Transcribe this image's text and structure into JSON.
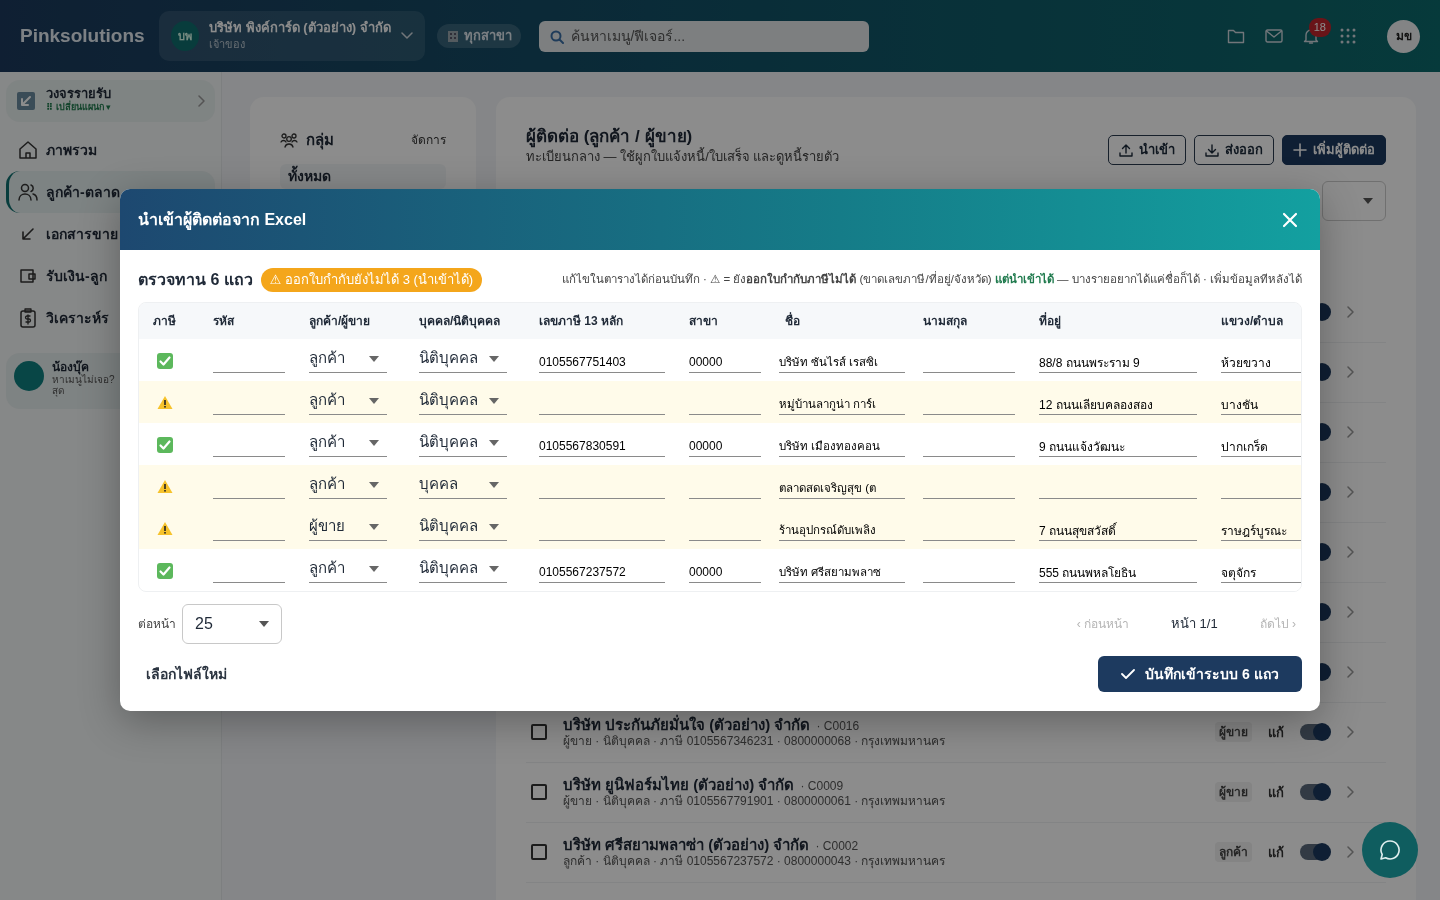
{
  "topbar": {
    "brand": "Pinksolutions",
    "company": {
      "initials": "บพ",
      "name": "บริษัท พิงค์การ์ด (ตัวอย่าง) จำกัด",
      "role": "เจ้าของ"
    },
    "branch": "ทุกสาขา",
    "search": {
      "placeholder": "ค้นหาเมนู/ฟีเจอร์..."
    },
    "notifications": "18",
    "user_initials": "มข"
  },
  "sidebar": {
    "module": {
      "title": "วงจรรายรับ",
      "switch_label": "⠿ เปลี่ยนแผนก ▾",
      "expanded": false
    },
    "items": [
      {
        "label": "ภาพรวม",
        "selected": false
      },
      {
        "label": "ลูกค้า-ตลาด",
        "selected": true
      },
      {
        "label": "เอกสารขาย",
        "selected": false
      },
      {
        "label": "รับเงิน-ลูก",
        "selected": false
      },
      {
        "label": "วิเคราะห์ร",
        "selected": false
      }
    ],
    "helper": {
      "title": "น้องบุ๊ค",
      "lines": [
        "หาเมนูไม่เจอ?",
        "สุด"
      ]
    }
  },
  "groups_panel": {
    "title": "กลุ่ม",
    "action": "จัดการ",
    "items": [
      "ทั้งหมด"
    ]
  },
  "contacts_page": {
    "title": "ผู้ติดต่อ (ลูกค้า / ผู้ขาย)",
    "subtitle": "ทะเบียนกลาง — ใช้ผูกใบแจ้งหนี้/ใบเสร็จ และดูหนี้รายตัว",
    "buttons": [
      {
        "label": "นำเข้า",
        "kind": "outline"
      },
      {
        "label": "ส่งออก",
        "kind": "outline"
      },
      {
        "label": "เพิ่มผู้ติดต่อ",
        "kind": "primary"
      }
    ],
    "list": [
      {
        "on": true
      },
      {
        "on": true
      },
      {
        "on": true
      },
      {
        "on": true
      },
      {
        "on": true
      },
      {
        "on": true
      },
      {
        "on": true
      },
      {
        "checked": false,
        "name": "บริษัท ประกันภัยมั่นใจ (ตัวอย่าง) จำกัด",
        "code": "· C0016",
        "details": "ผู้ขาย · นิติบุคคล · ภาษี 0105567346231 · 0800000068 · กรุงเทพมหานคร",
        "tag": "ผู้ขาย",
        "edit": "แก้",
        "on": true
      },
      {
        "checked": false,
        "name": "บริษัท ยูนิฟอร์มไทย (ตัวอย่าง) จำกัด",
        "code": "· C0009",
        "details": "ผู้ขาย · นิติบุคคล · ภาษี 0105567791901 · 0800000061 · กรุงเทพมหานคร",
        "tag": "ผู้ขาย",
        "edit": "แก้",
        "on": true
      },
      {
        "checked": false,
        "name": "บริษัท ศรีสยามพลาซ่า (ตัวอย่าง) จำกัด",
        "code": "· C0002",
        "details": "ลูกค้า · นิติบุคคล · ภาษี 0105567237572 · 0800000043 · กรุงเทพมหานคร",
        "tag": "ลูกค้า",
        "edit": "แก้",
        "on": true
      }
    ]
  },
  "modal": {
    "title": "นำเข้าผู้ติดต่อจาก Excel",
    "summary": "ตรวจทาน 6 แถว",
    "warning_badge": "⚠ ออกใบกำกับยังไม่ได้ 3 (นำเข้าได้)",
    "hint": "แก้ไขในตารางได้ก่อนบันทึก · ⚠ = ยัง**ออกใบกำกับภาษีไม่ได้** (ขาดเลขภาษี/ที่อยู่/จังหวัด) **แต่นำเข้าได้** — บางรายอยากได้แค่ชื่อก็ได้ · เพิ่มข้อมูลทีหลังได้",
    "table": {
      "columns": [
        "ภาษี",
        "รหัส",
        "ลูกค้า/ผู้ขาย",
        "บุคคล/นิติบุคคล",
        "เลขภาษี 13 หลัก",
        "สาขา",
        "ชื่อ",
        "นามสกุล",
        "ที่อยู่",
        "แขวง/ตำบล"
      ],
      "rows": [
        {
          "warning": false,
          "contact_type": "ลูกค้า",
          "entity": "นิติบุคคล",
          "tax_id": "0105567751403",
          "branch": "00000",
          "first_name": "บริษัท ซันไรส์ เรสซิเ",
          "address": "88/8 ถนนพระราม 9",
          "subdistrict": "ห้วยขวาง"
        },
        {
          "warning": true,
          "contact_type": "ลูกค้า",
          "entity": "นิติบุคคล",
          "first_name": "หมู่บ้านลากูน่า การ์เ",
          "address": "12 ถนนเลียบคลองสอง",
          "subdistrict": "บางชัน"
        },
        {
          "warning": false,
          "contact_type": "ลูกค้า",
          "entity": "นิติบุคคล",
          "tax_id": "0105567830591",
          "branch": "00000",
          "first_name": "บริษัท เมืองทองคอน",
          "address": "9 ถนนแจ้งวัฒนะ",
          "subdistrict": "ปากเกร็ด"
        },
        {
          "warning": true,
          "contact_type": "ลูกค้า",
          "entity": "บุคคล",
          "first_name": "ตลาดสดเจริญสุข (ต"
        },
        {
          "warning": true,
          "contact_type": "ผู้ขาย",
          "entity": "นิติบุคคล",
          "first_name": "ร้านอุปกรณ์ดับเพลิง",
          "address": "7 ถนนสุขสวัสดิ์",
          "subdistrict": "ราษฎร์บูรณะ"
        },
        {
          "warning": false,
          "contact_type": "ลูกค้า",
          "entity": "นิติบุคคล",
          "tax_id": "0105567237572",
          "branch": "00000",
          "first_name": "บริษัท ศรีสยามพลาซ",
          "address": "555 ถนนพหลโยธิน",
          "subdistrict": "จตุจักร"
        }
      ]
    },
    "per_page": {
      "label": "ต่อหน้า",
      "value": "25"
    },
    "pagination": {
      "prev": {
        "label": "‹ ก่อนหน้า",
        "disabled": true
      },
      "page": "หน้า 1/1",
      "next": {
        "label": "ถัดไป ›",
        "disabled": true
      }
    },
    "buttons": {
      "reselect": "เลือกไฟล์ใหม่",
      "save": "บันทึกเข้าระบบ 6 แถว"
    }
  }
}
